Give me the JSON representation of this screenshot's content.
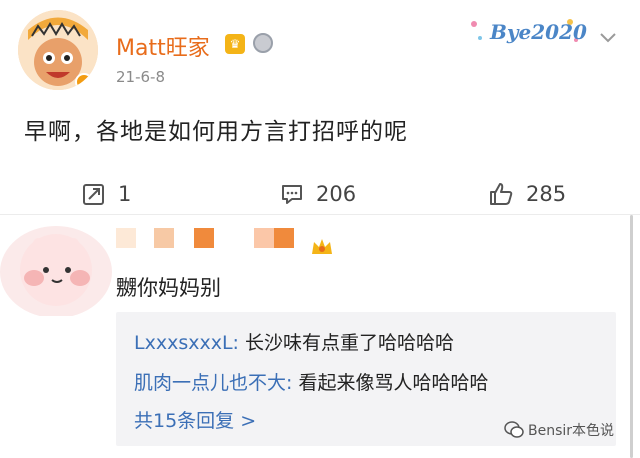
{
  "post": {
    "author": "Matt旺家",
    "date": "21-6-8",
    "year_badge": "Bye2020",
    "text": "早啊，各地是如何用方言打招呼的呢",
    "actions": {
      "repost_count": "1",
      "comment_count": "206",
      "like_count": "285"
    }
  },
  "comment": {
    "text": "嬲你妈妈别",
    "replies": [
      {
        "author": "LxxxsxxxL:",
        "text": " 长沙味有点重了哈哈哈哈"
      },
      {
        "author": "肌肉一点儿也不大:",
        "text": " 看起来像骂人哈哈哈哈"
      }
    ],
    "more_replies": "共15条回复 >"
  },
  "watermark": "Bensir本色说",
  "colors": {
    "username": "#e86c1b",
    "reply_author": "#3b6fb6",
    "reply_bg": "#f3f3f5"
  }
}
